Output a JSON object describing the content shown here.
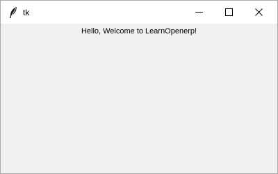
{
  "window": {
    "title": "tk",
    "icon": "feather-icon",
    "controls": {
      "minimize_icon": "minimize-icon",
      "maximize_icon": "maximize-icon",
      "close_icon": "close-icon"
    }
  },
  "content": {
    "label": "Hello, Welcome to LearnOpenerp!"
  },
  "colors": {
    "titlebar": "#ffffff",
    "client_background": "#f0f0f0",
    "window_border": "#aaaaaa",
    "text": "#000000"
  }
}
